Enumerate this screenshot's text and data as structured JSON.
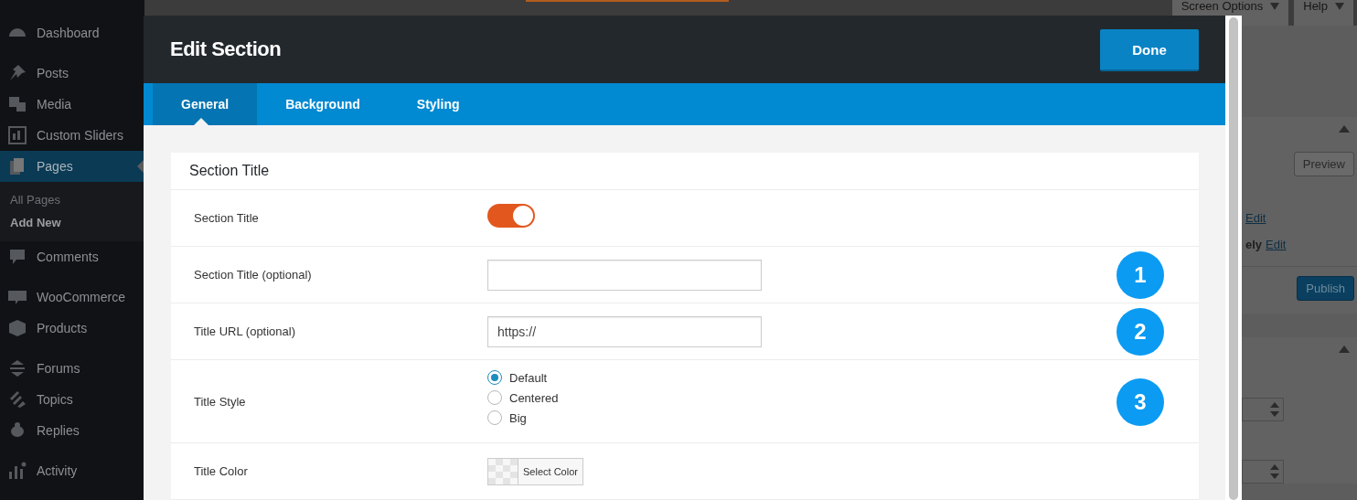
{
  "sidebar": {
    "groups": [
      {
        "items": [
          {
            "label": "Dashboard",
            "selected": false
          }
        ]
      },
      {
        "items": [
          {
            "label": "Posts",
            "selected": false
          },
          {
            "label": "Media",
            "selected": false
          },
          {
            "label": "Custom Sliders",
            "selected": false
          },
          {
            "label": "Pages",
            "selected": true,
            "children": [
              {
                "label": "All Pages",
                "selected": false
              },
              {
                "label": "Add New",
                "selected": true
              }
            ]
          },
          {
            "label": "Comments",
            "selected": false
          }
        ]
      },
      {
        "items": [
          {
            "label": "WooCommerce",
            "selected": false
          },
          {
            "label": "Products",
            "selected": false
          }
        ]
      },
      {
        "items": [
          {
            "label": "Forums",
            "selected": false
          },
          {
            "label": "Topics",
            "selected": false
          },
          {
            "label": "Replies",
            "selected": false
          }
        ]
      },
      {
        "items": [
          {
            "label": "Activity",
            "selected": false
          }
        ]
      }
    ]
  },
  "background_page": {
    "tabs": [
      {
        "label": "Screen Options"
      },
      {
        "label": "Help"
      }
    ],
    "preview_button": "Preview",
    "links": [
      {
        "label": "Edit"
      },
      {
        "prefix": "ely",
        "label": "Edit"
      }
    ],
    "publish_button": "Publish"
  },
  "modal": {
    "title": "Edit Section",
    "done_button": "Done",
    "tabs": [
      {
        "label": "General",
        "selected": true
      },
      {
        "label": "Background",
        "selected": false
      },
      {
        "label": "Styling",
        "selected": false
      }
    ],
    "panel": {
      "heading": "Section Title",
      "fields": [
        {
          "kind": "toggle",
          "label": "Section Title",
          "on": true
        },
        {
          "kind": "text",
          "label": "Section Title (optional)",
          "callout": "1"
        },
        {
          "kind": "text",
          "label": "Title URL (optional)",
          "value": "https://",
          "callout": "2"
        },
        {
          "kind": "radio",
          "label": "Title Style",
          "callout": "3",
          "options": [
            {
              "label": "Default",
              "selected": true
            },
            {
              "label": "Centered",
              "selected": false
            },
            {
              "label": "Big",
              "selected": false
            }
          ]
        },
        {
          "kind": "color",
          "label": "Title Color",
          "button": "Select Color"
        }
      ]
    }
  }
}
